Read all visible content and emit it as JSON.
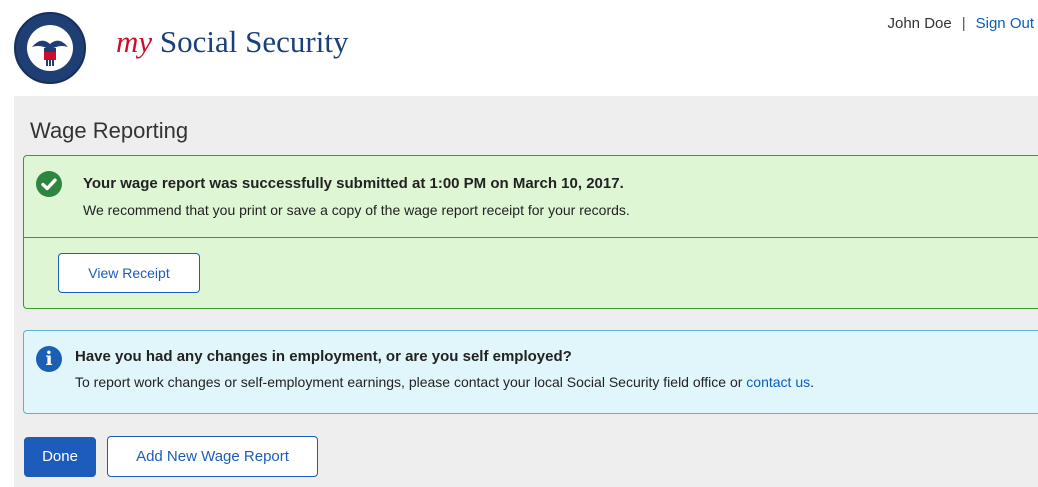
{
  "header": {
    "brand_my": "my",
    "brand_rest": "Social Security",
    "user_name": "John Doe",
    "separator": "|",
    "sign_out": "Sign Out",
    "seal": {
      "top_text": "SOCIAL SECURITY",
      "bottom_text": "ADMINISTRATION",
      "center_text": "USA"
    }
  },
  "page": {
    "title": "Wage Reporting"
  },
  "success": {
    "title": "Your wage report was successfully submitted at 1:00 PM on March 10, 2017.",
    "text": "We recommend that you print or save a copy of the wage report receipt for your records.",
    "button": "View Receipt",
    "color": "#2e8540"
  },
  "info": {
    "title": "Have you had any changes in employment, or are you self employed?",
    "text": "To report work changes or self-employment earnings, please contact your local Social Security field office or ",
    "link": "contact us",
    "trailing": ".",
    "icon_glyph": "i",
    "color": "#1a5fb4"
  },
  "actions": {
    "done": "Done",
    "add_new": "Add New Wage Report"
  }
}
